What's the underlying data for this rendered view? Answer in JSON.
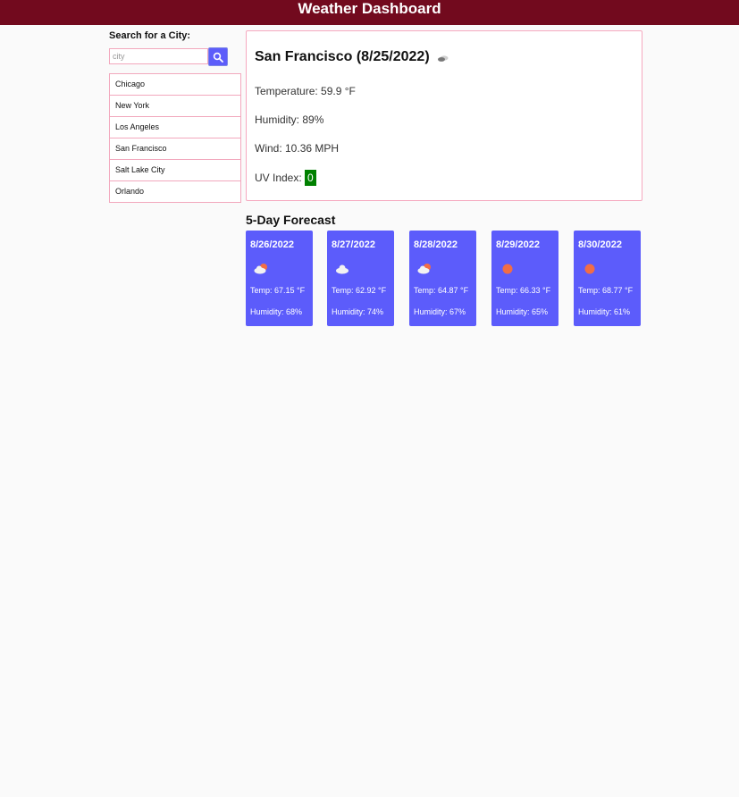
{
  "header": {
    "title": "Weather Dashboard"
  },
  "sidebar": {
    "search_label": "Search for a City:",
    "search_placeholder": "city",
    "search_icon": "search-icon",
    "cities": [
      "Chicago",
      "New York",
      "Los Angeles",
      "San Francisco",
      "Salt Lake City",
      "Orlando"
    ]
  },
  "current": {
    "title": "San Francisco (8/25/2022)",
    "icon": "broken-clouds-icon",
    "temperature": "Temperature: 59.9 °F",
    "humidity": "Humidity: 89%",
    "wind": "Wind: 10.36 MPH",
    "uv_label": "UV Index:",
    "uv_value": "0",
    "uv_color": "#008000"
  },
  "forecast": {
    "heading": "5-Day Forecast",
    "days": [
      {
        "date": "8/26/2022",
        "icon": "partly-cloudy-icon",
        "temp": "Temp: 67.15 °F",
        "humidity": "Humidity: 68%"
      },
      {
        "date": "8/27/2022",
        "icon": "cloud-icon",
        "temp": "Temp: 62.92 °F",
        "humidity": "Humidity: 74%"
      },
      {
        "date": "8/28/2022",
        "icon": "partly-cloudy-icon",
        "temp": "Temp: 64.87 °F",
        "humidity": "Humidity: 67%"
      },
      {
        "date": "8/29/2022",
        "icon": "sun-icon",
        "temp": "Temp: 66.33 °F",
        "humidity": "Humidity: 65%"
      },
      {
        "date": "8/30/2022",
        "icon": "sun-icon",
        "temp": "Temp: 68.77 °F",
        "humidity": "Humidity: 61%"
      }
    ]
  },
  "colors": {
    "header_bg": "#720a1e",
    "card_bg": "#5c5cfb",
    "border": "#f2a8bd",
    "uv_low": "#008000"
  }
}
